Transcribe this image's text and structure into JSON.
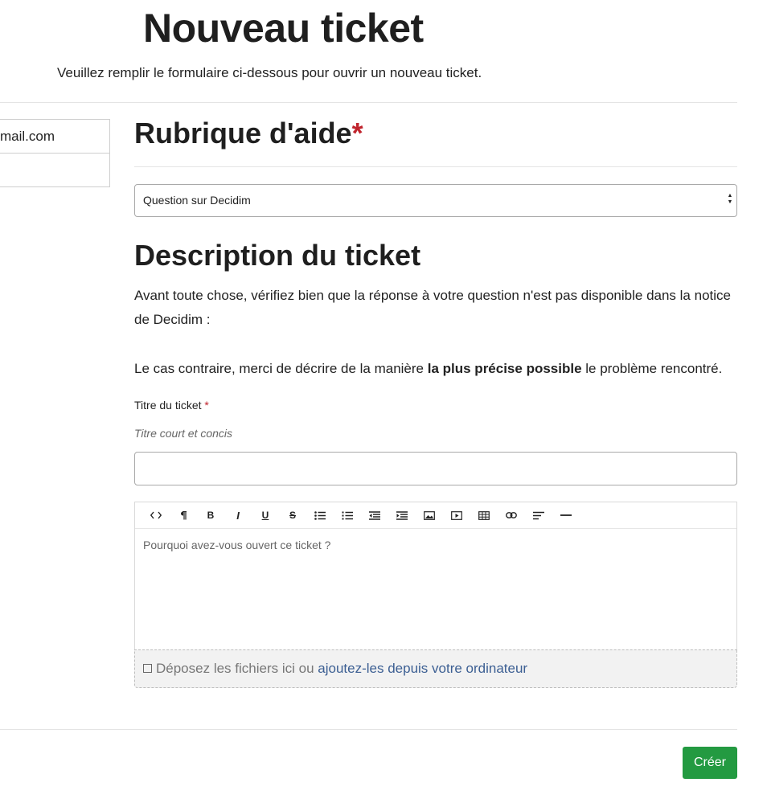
{
  "page": {
    "title": "Nouveau ticket",
    "subtitle": "Veuillez remplir le formulaire ci-dessous pour ouvrir un nouveau ticket."
  },
  "left_panel": {
    "rows": [
      "mail.com",
      ""
    ]
  },
  "help_section": {
    "title": "Rubrique d'aide",
    "required_mark": "*",
    "selected_value": "Question sur Decidim"
  },
  "description_section": {
    "title": "Description du ticket",
    "paragraph1": "Avant toute chose, vérifiez bien que la réponse à votre question n'est pas disponible dans la notice de Decidim :",
    "paragraph2_before": "Le cas contraire, merci de décrire de la manière ",
    "paragraph2_bold": "la plus précise possible",
    "paragraph2_after": " le problème rencontré."
  },
  "ticket_title_field": {
    "label": "Titre du ticket",
    "required_mark": "*",
    "help_text": "Titre court et concis",
    "value": ""
  },
  "editor": {
    "placeholder": "Pourquoi avez-vous ouvert ce ticket ?",
    "toolbar_icons": [
      "code-icon",
      "paragraph-icon",
      "bold-icon",
      "italic-icon",
      "underline-icon",
      "strikethrough-icon",
      "bullet-list-icon",
      "ordered-list-icon",
      "outdent-icon",
      "indent-icon",
      "image-icon",
      "video-icon",
      "table-icon",
      "link-icon",
      "align-icon",
      "horizontal-rule-icon"
    ]
  },
  "dropzone": {
    "text": "Déposez les fichiers ici ou ",
    "link": "ajoutez-les depuis votre ordinateur"
  },
  "actions": {
    "submit_label": "Créer"
  },
  "colors": {
    "primary_button": "#239a41",
    "required": "#c0242d",
    "link": "#3c5f93"
  }
}
